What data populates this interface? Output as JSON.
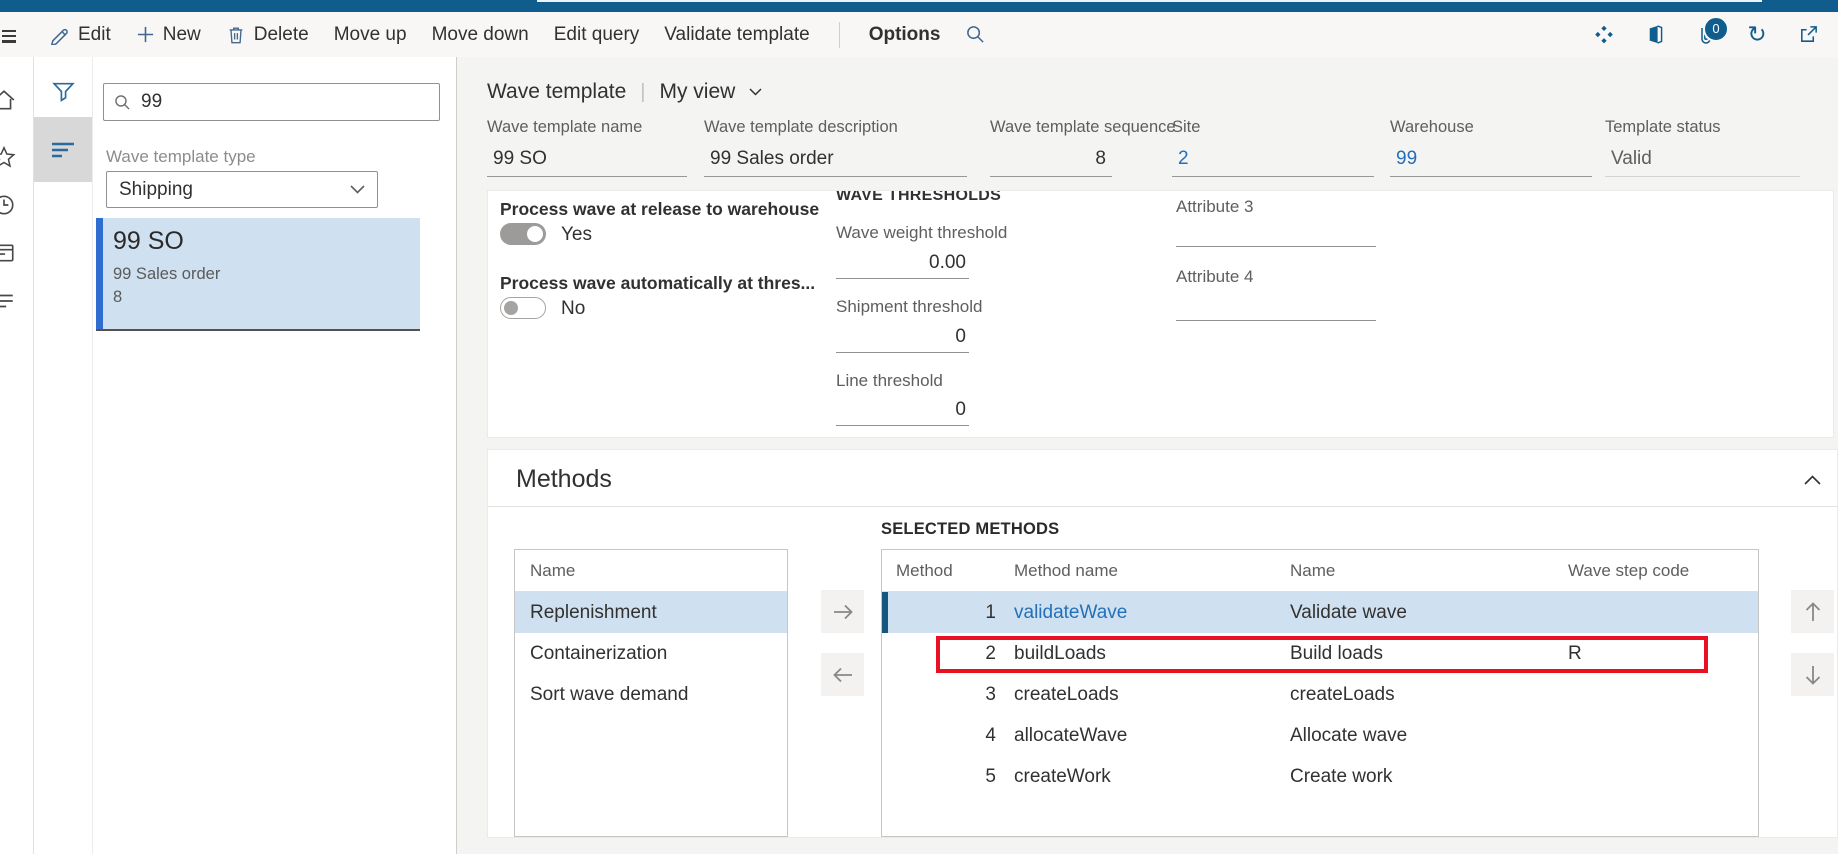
{
  "colors": {
    "accent": "#0f5c8d",
    "selection": "#cfe1f0",
    "link": "#2470b8",
    "highlight": "#e81123",
    "list_accent": "#2f6dd0"
  },
  "toolbar": {
    "edit": "Edit",
    "new": "New",
    "delete": "Delete",
    "move_up": "Move up",
    "move_down": "Move down",
    "edit_query": "Edit query",
    "validate_template": "Validate template",
    "options": "Options",
    "attachments_count": "0"
  },
  "icons": {
    "refresh_glyph": "↻"
  },
  "filter_pane": {
    "search_value": "99",
    "type_label": "Wave template type",
    "type_value": "Shipping",
    "selected_item": {
      "title": "99 SO",
      "subtitle": "99 Sales order",
      "sequence": "8"
    }
  },
  "page": {
    "title": "Wave template",
    "view": "My view",
    "pipe": "|",
    "fields": [
      {
        "label": "Wave template name",
        "value": "99 SO"
      },
      {
        "label": "Wave template description",
        "value": "99 Sales order"
      },
      {
        "label": "Wave template sequence",
        "value": "8"
      },
      {
        "label": "Site",
        "value": "2"
      },
      {
        "label": "Warehouse",
        "value": "99"
      },
      {
        "label": "Template status",
        "value": "Valid"
      }
    ],
    "general": {
      "toggle1_label": "Process wave at release to warehouse",
      "toggle1_value": "Yes",
      "toggle2_label": "Process wave automatically at thres...",
      "toggle2_value": "No",
      "thresholds_title": "WAVE THRESHOLDS",
      "weight_label": "Wave weight threshold",
      "weight_value": "0.00",
      "shipment_label": "Shipment threshold",
      "shipment_value": "0",
      "line_label": "Line threshold",
      "line_value": "0",
      "attr3_label": "Attribute 3",
      "attr4_label": "Attribute 4"
    },
    "methods": {
      "title": "Methods",
      "available_header": "Name",
      "available": [
        "Replenishment",
        "Containerization",
        "Sort wave demand"
      ],
      "selected_title": "SELECTED METHODS",
      "columns": [
        "Method sequ...",
        "Method name",
        "Name",
        "Wave step code"
      ],
      "rows": [
        {
          "seq": "1",
          "method": "validateWave",
          "name": "Validate wave",
          "code": ""
        },
        {
          "seq": "2",
          "method": "buildLoads",
          "name": "Build loads",
          "code": "R"
        },
        {
          "seq": "3",
          "method": "createLoads",
          "name": "createLoads",
          "code": ""
        },
        {
          "seq": "4",
          "method": "allocateWave",
          "name": "Allocate wave",
          "code": ""
        },
        {
          "seq": "5",
          "method": "createWork",
          "name": "Create work",
          "code": ""
        }
      ]
    }
  }
}
